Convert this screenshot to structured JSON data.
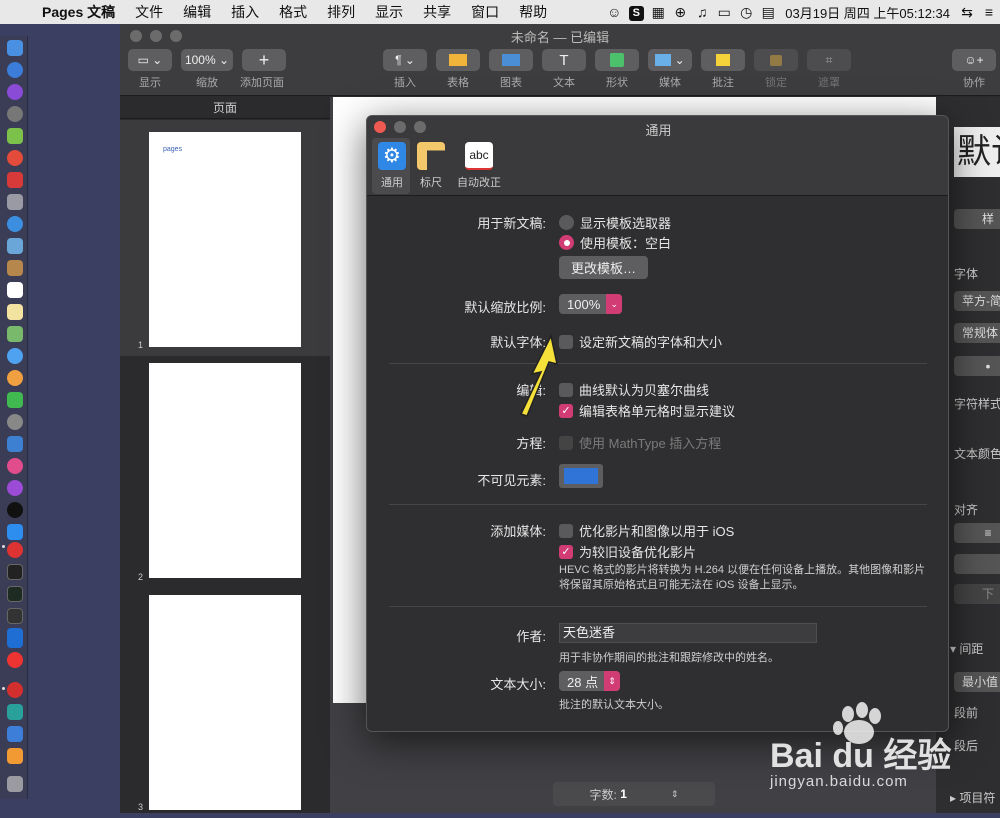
{
  "menubar": {
    "app": "Pages 文稿",
    "menus": [
      "文件",
      "编辑",
      "插入",
      "格式",
      "排列",
      "显示",
      "共享",
      "窗口",
      "帮助"
    ],
    "datetime": "03月19日 周四 上午05:12:34"
  },
  "document": {
    "title": "未命名 — 已编辑",
    "toolbar": {
      "view": "显示",
      "zoom_value": "100%",
      "zoom": "缩放",
      "add_page": "添加页面",
      "insert": "插入",
      "table": "表格",
      "chart": "图表",
      "text": "文本",
      "shape": "形状",
      "media": "媒体",
      "comment": "批注",
      "lock": "锁定",
      "mask": "遮罩",
      "collaborate": "协作"
    },
    "sidebar": {
      "header": "页面",
      "page1_text": "pages",
      "page_numbers": [
        "1",
        "2",
        "3"
      ]
    },
    "wordcount": {
      "label": "字数:",
      "value": "1"
    }
  },
  "inspector": {
    "style_title": "默认",
    "style_btn": "样",
    "font_label": "字体",
    "font_name": "苹方-简",
    "font_style": "常规体",
    "char_style": "字符样式",
    "text_color": "文本颜色",
    "align": "对齐",
    "spacing": "间距",
    "min_value": "最小值",
    "before_para": "段前",
    "after_para": "段后",
    "bullets": "项目符",
    "down": "下"
  },
  "prefs": {
    "title": "通用",
    "tabs": [
      "通用",
      "标尺",
      "自动改正"
    ],
    "new_doc_label": "用于新文稿:",
    "opt_show_chooser": "显示模板选取器",
    "opt_use_template": "使用模板：空白",
    "change_template": "更改模板…",
    "zoom_label": "默认缩放比例:",
    "zoom_value": "100%",
    "font_label": "默认字体:",
    "font_check": "设定新文稿的字体和大小",
    "edit_label": "编辑:",
    "bezier": "曲线默认为贝塞尔曲线",
    "table_suggest": "编辑表格单元格时显示建议",
    "equation_label": "方程:",
    "mathtype": "使用 MathType 插入方程",
    "invisibles_label": "不可见元素:",
    "invisibles_color": "#2f74d6",
    "media_label": "添加媒体:",
    "optimize_ios": "优化影片和图像以用于 iOS",
    "optimize_old": "为较旧设备优化影片",
    "hevc_note": "HEVC 格式的影片将转换为 H.264 以便在任何设备上播放。其他图像和影片将保留其原始格式且可能无法在 iOS 设备上显示。",
    "author_label": "作者:",
    "author_value": "天色迷香",
    "author_note": "用于非协作期间的批注和跟踪修改中的姓名。",
    "textsize_label": "文本大小:",
    "textsize_value": "28 点",
    "textsize_note": "批注的默认文本大小。"
  },
  "watermark": {
    "brand": "Bai du 经验",
    "url": "jingyan.baidu.com"
  },
  "colors": {
    "accent": "#d23c74",
    "arrow": "#f5e13a"
  }
}
